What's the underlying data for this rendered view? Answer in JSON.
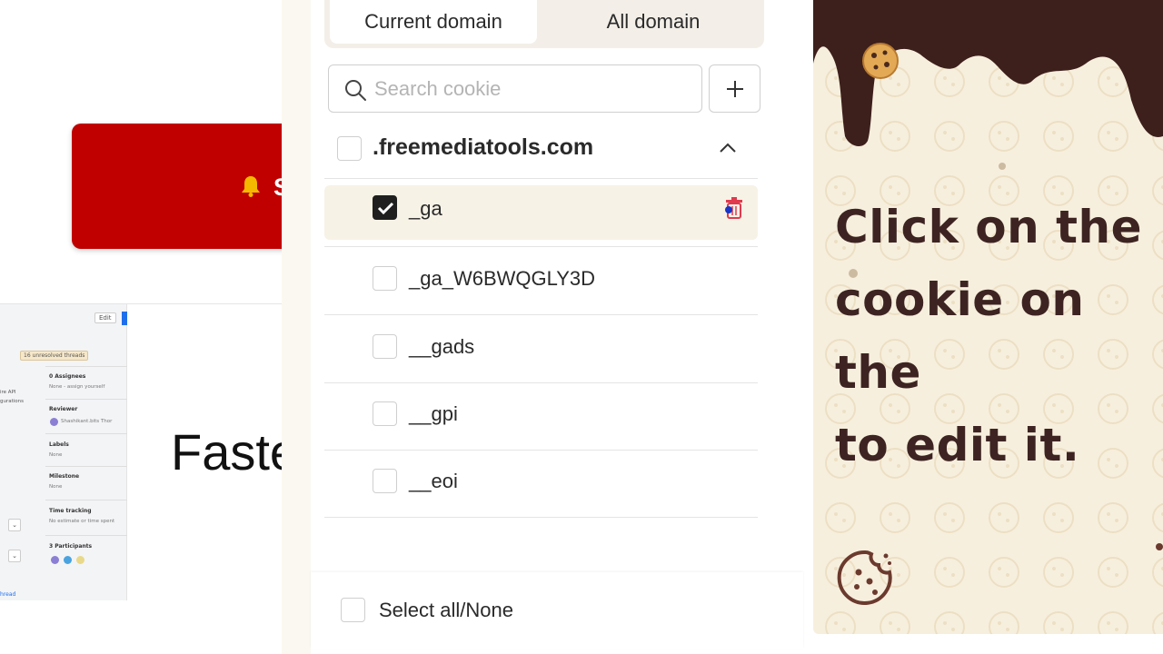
{
  "background_page": {
    "subscribe_label": "Subscr",
    "headline_fragment": "Faste",
    "mock_ui": {
      "edit_label": "Edit",
      "threads_label": "16 unresolved threads",
      "assignees_label": "0 Assignees",
      "assignees_value": "None - assign yourself",
      "reviewer_label": "Reviewer",
      "reviewer_value": "Shashikant.bits Thor",
      "labels_label": "Labels",
      "labels_value": "None",
      "milestone_label": "Milestone",
      "milestone_value": "None",
      "time_tracking_label": "Time tracking",
      "time_tracking_value": "No estimate or time spent",
      "participants_label": "3 Participants",
      "left_text_1": "ire API",
      "left_text_2": "gurations",
      "thread_link": "hread"
    }
  },
  "extension": {
    "tabs": [
      {
        "label": "Current domain",
        "active": true
      },
      {
        "label": "All domain",
        "active": false
      }
    ],
    "search": {
      "placeholder": "Search cookie",
      "value": ""
    },
    "add_button_icon": "plus-icon",
    "domain": {
      "name": ".freemediatools.com",
      "checked": false,
      "expanded": true
    },
    "cookies": [
      {
        "name": "_ga",
        "checked": true,
        "selected": true
      },
      {
        "name": "_ga_W6BWQGLY3D",
        "checked": false,
        "selected": false
      },
      {
        "name": "__gads",
        "checked": false,
        "selected": false
      },
      {
        "name": "__gpi",
        "checked": false,
        "selected": false
      },
      {
        "name": "__eoi",
        "checked": false,
        "selected": false
      }
    ],
    "footer": {
      "select_all_label": "Select all/None",
      "checked": false
    }
  },
  "help_panel": {
    "message_lines": [
      "Click on the",
      "cookie on the",
      "to edit it."
    ]
  },
  "colors": {
    "subscribe_red": "#c00000",
    "help_bg": "#f7efdd",
    "chocolate": "#3d2422",
    "selected_row": "#f7f2e6"
  }
}
